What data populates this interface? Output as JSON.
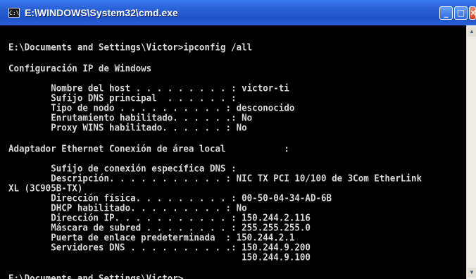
{
  "window": {
    "title": "E:\\WINDOWS\\System32\\cmd.exe",
    "icon": "C:\\",
    "buttons": {
      "minimize": "_",
      "maximize": "□",
      "close": "×"
    }
  },
  "console": {
    "lines": [
      "E:\\Documents and Settings\\Victor>ipconfig /all",
      "",
      "Configuración IP de Windows",
      "",
      "        Nombre del host . . . . . . . . . : victor-ti",
      "        Sufijo DNS principal  . . . . . . :",
      "        Tipo de nodo . . . . . . . . . . : desconocido",
      "        Enrutamiento habilitado. . . . . .: No",
      "        Proxy WINS habilitado. . . . . . : No",
      "",
      "Adaptador Ethernet Conexión de área local           :",
      "",
      "        Sufijo de conexión específica DNS :",
      "        Descripción. . . . . . . . . . . : NIC TX PCI 10/100 de 3Com EtherLink",
      "XL (3C905B-TX)",
      "        Dirección física. . . . . . . . . : 00-50-04-34-AD-6B",
      "        DHCP habilitado. . . . . . . . . : No",
      "        Dirección IP. . . . . . . . . . . : 150.244.2.116",
      "        Máscara de subred . . . . . . . . : 255.255.255.0",
      "        Puerta de enlace predeterminada  : 150.244.2.1",
      "        Servidores DNS . . . . . . . . . .: 150.244.9.200",
      "                                            150.244.9.100",
      "",
      "E:\\Documents and Settings\\Victor>"
    ]
  },
  "colors": {
    "console_bg": "#000000",
    "console_text": "#d8d8d8",
    "titlebar": "#2b63d8"
  }
}
